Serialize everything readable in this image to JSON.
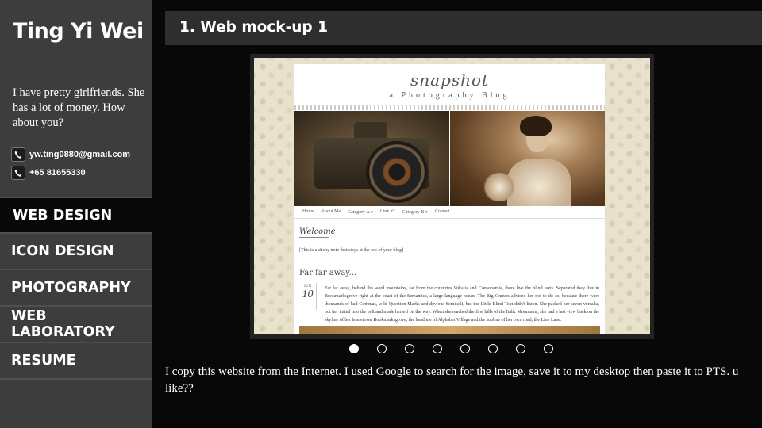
{
  "profile": {
    "name": "Ting Yi Wei",
    "bio": "I have pretty girlfriends. She has a lot of money. How about you?",
    "email": "yw.ting0880@gmail.com",
    "phone": "+65 81655330"
  },
  "nav": {
    "items": [
      {
        "label": "WEB DESIGN",
        "active": true
      },
      {
        "label": "ICON DESIGN",
        "active": false
      },
      {
        "label": "PHOTOGRAPHY",
        "active": false
      },
      {
        "label": "WEB LABORATORY",
        "active": false
      },
      {
        "label": "RESUME",
        "active": false
      }
    ]
  },
  "section": {
    "title": "1. Web mock-up 1"
  },
  "mockup": {
    "blog_title": "snapshot",
    "blog_subtitle": "a Photography Blog",
    "nav": [
      "Home",
      "About Me",
      "Category A ▿",
      "Link #2",
      "Category B ▿",
      "Contact"
    ],
    "welcome": "Welcome",
    "sticky_note": "[This is a sticky note that stays at the top of your blog]",
    "post_title": "Far far away...",
    "post_month": "JUN",
    "post_day": "10",
    "post_body": "Far far away, behind the word mountains, far from the countries Vokalia and Consonantia, there live the blind texts. Separated they live in Bookmarksgrove right at the coast of the Semantics, a large language ocean. The Big Oxmox advised her not to do so, because there were thousands of bad Commas, wild Question Marks and devious Semikoli, but the Little Blind Text didn't listen. She packed her seven versalia, put her initial into the belt and made herself on the way. When she reached the first hills of the Italic Mountains, she had a last view back on the skyline of her hometown Bookmarksgrove, the headline of Alphabet Village and the subline of her own road, the Line Lane."
  },
  "slider": {
    "count": 8,
    "active_index": 0
  },
  "caption": "I copy this website from the Internet. I used Google to search for the image, save it to my desktop then paste it to PTS. u like??",
  "colors": {
    "sidebar": "#3d3d3d",
    "active_nav": "#080808",
    "header_bar": "#2e2e2e",
    "background": "#080808"
  },
  "icons": {
    "email": "envelope-icon",
    "phone": "phone-icon"
  }
}
